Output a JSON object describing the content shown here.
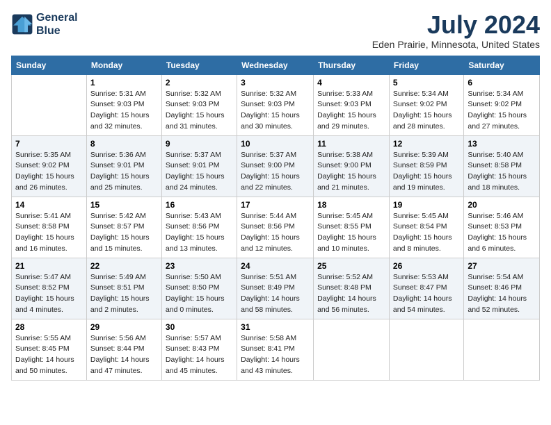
{
  "logo": {
    "line1": "General",
    "line2": "Blue"
  },
  "title": "July 2024",
  "location": "Eden Prairie, Minnesota, United States",
  "weekdays": [
    "Sunday",
    "Monday",
    "Tuesday",
    "Wednesday",
    "Thursday",
    "Friday",
    "Saturday"
  ],
  "weeks": [
    [
      {
        "day": "",
        "sunrise": "",
        "sunset": "",
        "daylight": ""
      },
      {
        "day": "1",
        "sunrise": "5:31 AM",
        "sunset": "9:03 PM",
        "daylight": "15 hours and 32 minutes."
      },
      {
        "day": "2",
        "sunrise": "5:32 AM",
        "sunset": "9:03 PM",
        "daylight": "15 hours and 31 minutes."
      },
      {
        "day": "3",
        "sunrise": "5:32 AM",
        "sunset": "9:03 PM",
        "daylight": "15 hours and 30 minutes."
      },
      {
        "day": "4",
        "sunrise": "5:33 AM",
        "sunset": "9:03 PM",
        "daylight": "15 hours and 29 minutes."
      },
      {
        "day": "5",
        "sunrise": "5:34 AM",
        "sunset": "9:02 PM",
        "daylight": "15 hours and 28 minutes."
      },
      {
        "day": "6",
        "sunrise": "5:34 AM",
        "sunset": "9:02 PM",
        "daylight": "15 hours and 27 minutes."
      }
    ],
    [
      {
        "day": "7",
        "sunrise": "5:35 AM",
        "sunset": "9:02 PM",
        "daylight": "15 hours and 26 minutes."
      },
      {
        "day": "8",
        "sunrise": "5:36 AM",
        "sunset": "9:01 PM",
        "daylight": "15 hours and 25 minutes."
      },
      {
        "day": "9",
        "sunrise": "5:37 AM",
        "sunset": "9:01 PM",
        "daylight": "15 hours and 24 minutes."
      },
      {
        "day": "10",
        "sunrise": "5:37 AM",
        "sunset": "9:00 PM",
        "daylight": "15 hours and 22 minutes."
      },
      {
        "day": "11",
        "sunrise": "5:38 AM",
        "sunset": "9:00 PM",
        "daylight": "15 hours and 21 minutes."
      },
      {
        "day": "12",
        "sunrise": "5:39 AM",
        "sunset": "8:59 PM",
        "daylight": "15 hours and 19 minutes."
      },
      {
        "day": "13",
        "sunrise": "5:40 AM",
        "sunset": "8:58 PM",
        "daylight": "15 hours and 18 minutes."
      }
    ],
    [
      {
        "day": "14",
        "sunrise": "5:41 AM",
        "sunset": "8:58 PM",
        "daylight": "15 hours and 16 minutes."
      },
      {
        "day": "15",
        "sunrise": "5:42 AM",
        "sunset": "8:57 PM",
        "daylight": "15 hours and 15 minutes."
      },
      {
        "day": "16",
        "sunrise": "5:43 AM",
        "sunset": "8:56 PM",
        "daylight": "15 hours and 13 minutes."
      },
      {
        "day": "17",
        "sunrise": "5:44 AM",
        "sunset": "8:56 PM",
        "daylight": "15 hours and 12 minutes."
      },
      {
        "day": "18",
        "sunrise": "5:45 AM",
        "sunset": "8:55 PM",
        "daylight": "15 hours and 10 minutes."
      },
      {
        "day": "19",
        "sunrise": "5:45 AM",
        "sunset": "8:54 PM",
        "daylight": "15 hours and 8 minutes."
      },
      {
        "day": "20",
        "sunrise": "5:46 AM",
        "sunset": "8:53 PM",
        "daylight": "15 hours and 6 minutes."
      }
    ],
    [
      {
        "day": "21",
        "sunrise": "5:47 AM",
        "sunset": "8:52 PM",
        "daylight": "15 hours and 4 minutes."
      },
      {
        "day": "22",
        "sunrise": "5:49 AM",
        "sunset": "8:51 PM",
        "daylight": "15 hours and 2 minutes."
      },
      {
        "day": "23",
        "sunrise": "5:50 AM",
        "sunset": "8:50 PM",
        "daylight": "15 hours and 0 minutes."
      },
      {
        "day": "24",
        "sunrise": "5:51 AM",
        "sunset": "8:49 PM",
        "daylight": "14 hours and 58 minutes."
      },
      {
        "day": "25",
        "sunrise": "5:52 AM",
        "sunset": "8:48 PM",
        "daylight": "14 hours and 56 minutes."
      },
      {
        "day": "26",
        "sunrise": "5:53 AM",
        "sunset": "8:47 PM",
        "daylight": "14 hours and 54 minutes."
      },
      {
        "day": "27",
        "sunrise": "5:54 AM",
        "sunset": "8:46 PM",
        "daylight": "14 hours and 52 minutes."
      }
    ],
    [
      {
        "day": "28",
        "sunrise": "5:55 AM",
        "sunset": "8:45 PM",
        "daylight": "14 hours and 50 minutes."
      },
      {
        "day": "29",
        "sunrise": "5:56 AM",
        "sunset": "8:44 PM",
        "daylight": "14 hours and 47 minutes."
      },
      {
        "day": "30",
        "sunrise": "5:57 AM",
        "sunset": "8:43 PM",
        "daylight": "14 hours and 45 minutes."
      },
      {
        "day": "31",
        "sunrise": "5:58 AM",
        "sunset": "8:41 PM",
        "daylight": "14 hours and 43 minutes."
      },
      {
        "day": "",
        "sunrise": "",
        "sunset": "",
        "daylight": ""
      },
      {
        "day": "",
        "sunrise": "",
        "sunset": "",
        "daylight": ""
      },
      {
        "day": "",
        "sunrise": "",
        "sunset": "",
        "daylight": ""
      }
    ]
  ],
  "labels": {
    "sunrise_prefix": "Sunrise: ",
    "sunset_prefix": "Sunset: ",
    "daylight_prefix": "Daylight: "
  }
}
